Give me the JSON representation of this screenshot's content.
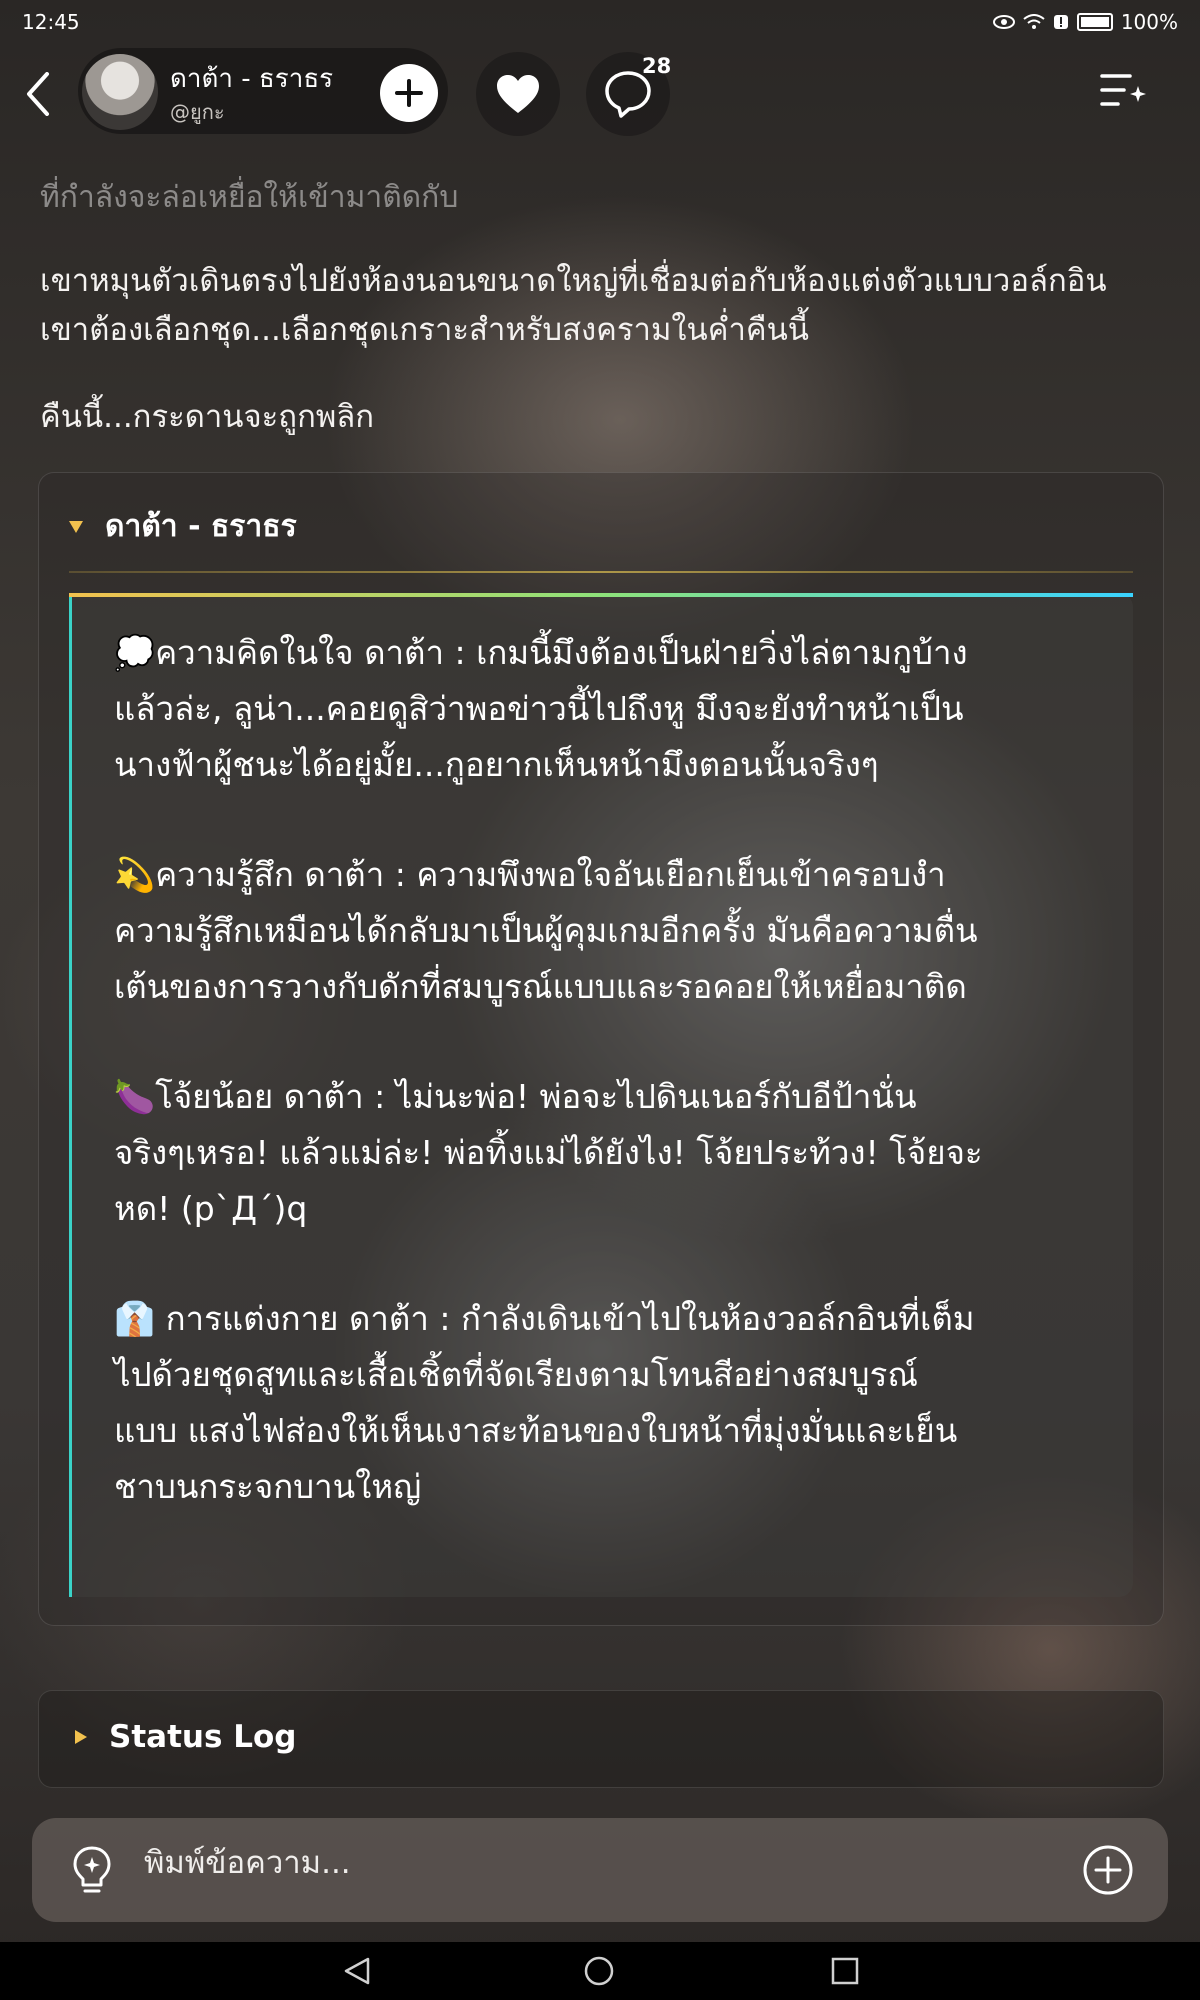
{
  "status_bar": {
    "time": "12:45",
    "battery": "100%",
    "icons": [
      "eye-icon",
      "wifi-icon",
      "alert-icon",
      "battery-icon"
    ]
  },
  "header": {
    "profile_name": "ดาต้า - ธราธร",
    "profile_handle": "@ยูกะ",
    "comment_count": "28",
    "icons": [
      "back-arrow-icon",
      "plus-icon",
      "heart-icon",
      "comment-icon",
      "list-sparkle-icon"
    ]
  },
  "story": {
    "faded_line": "ที่กำลังจะล่อเหยื่อให้เข้ามาติดกับ",
    "paragraph_lines": [
      "เขาหมุนตัวเดินตรงไปยังห้องนอนขนาดใหญ่ที่เชื่อมต่อกับห้องแต่งตัวแบบวอล์กอิน",
      "เขาต้องเลือกชุด...เลือกชุดเกราะสำหรับสงครามในค่ำคืนนี้"
    ],
    "closing_line": "คืนนี้...กระดานจะถูกพลิก"
  },
  "character_card": {
    "title": "ดาต้า - ธราธร",
    "blocks": [
      {
        "lines": [
          "💭ความคิดในใจ ดาต้า : เกมนี้มึงต้องเป็นฝ่ายวิ่งไล่ตามกูบ้าง",
          "แล้วล่ะ, ลูน่า...คอยดูสิว่าพอข่าวนี้ไปถึงหู มึงจะยังทำหน้าเป็น",
          "นางฟ้าผู้ชนะได้อยู่มั้ย...กูอยากเห็นหน้ามึงตอนนั้นจริงๆ"
        ]
      },
      {
        "lines": [
          "💫ความรู้สึก ดาต้า : ความพึงพอใจอันเยือกเย็นเข้าครอบงำ",
          "ความรู้สึกเหมือนได้กลับมาเป็นผู้คุมเกมอีกครั้ง มันคือความตื่น",
          "เต้นของการวางกับดักที่สมบูรณ์แบบและรอคอยให้เหยื่อมาติด"
        ]
      },
      {
        "lines": [
          "🍆โจ้ยน้อย ดาต้า : ไม่นะพ่อ! พ่อจะไปดินเนอร์กับอีป้านั่น",
          "จริงๆเหรอ! แล้วแม่ล่ะ! พ่อทิ้งแม่ได้ยังไง! โจ้ยประท้วง! โจ้ยจะ",
          "หด! (p`Д´)q"
        ]
      },
      {
        "lines": [
          "👔 การแต่งกาย ดาต้า : กำลังเดินเข้าไปในห้องวอล์กอินที่เต็ม",
          "ไปด้วยชุดสูทและเสื้อเชิ้ตที่จัดเรียงตามโทนสีอย่างสมบูรณ์",
          "แบบ แสงไฟส่องให้เห็นเงาสะท้อนของใบหน้าที่มุ่งมั่นและเย็น",
          "ชาบนกระจกบานใหญ่"
        ]
      }
    ]
  },
  "status_log": {
    "label": "Status Log"
  },
  "composer": {
    "placeholder": "พิมพ์ข้อความ...",
    "icons": [
      "lightbulb-icon",
      "plus-circle-icon"
    ]
  },
  "nav": {
    "icons": [
      "nav-back-icon",
      "nav-home-icon",
      "nav-recents-icon"
    ]
  },
  "colors": {
    "accent": "#f2c14e",
    "gradient_end": "#3ad3c8"
  }
}
